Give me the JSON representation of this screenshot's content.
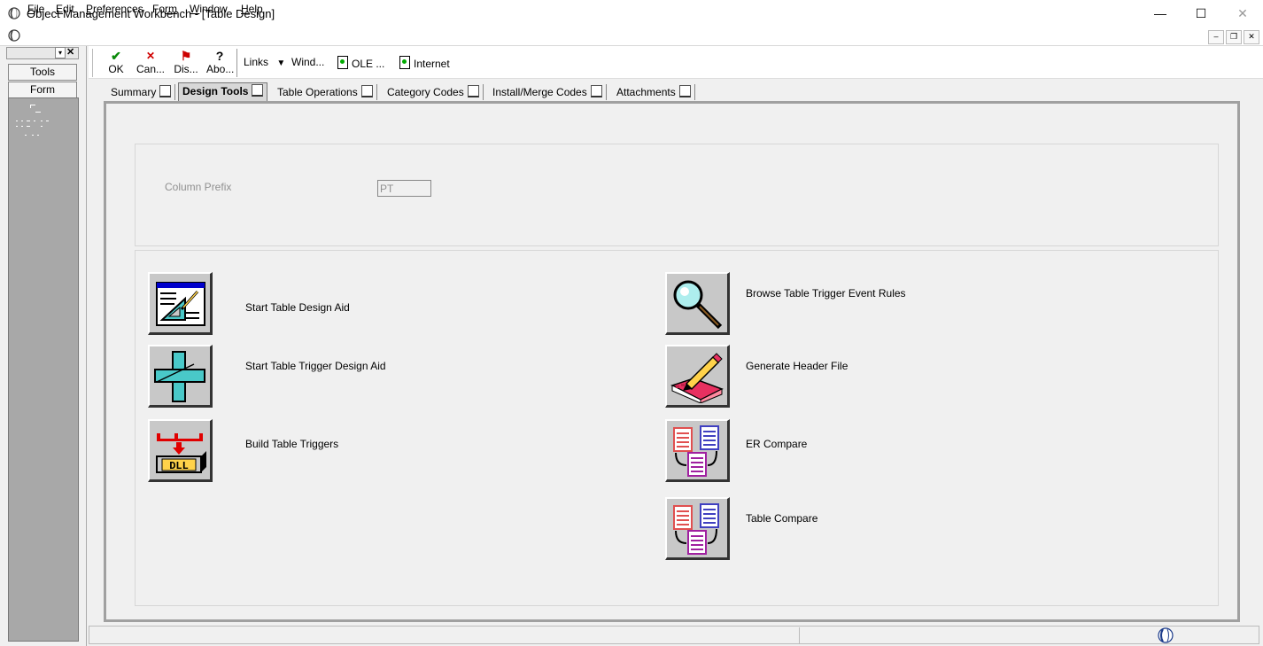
{
  "window": {
    "title": "Object Management Workbench - [Table Design]",
    "minimize_glyph": "—",
    "maximize_glyph": "☐",
    "close_glyph": "✕"
  },
  "menu": {
    "items": [
      {
        "key": "F",
        "rest": "ile"
      },
      {
        "key": "E",
        "rest": "dit"
      },
      {
        "key": "P",
        "rest": "references"
      },
      {
        "key": "Fo",
        "rest": "rm"
      },
      {
        "key": "W",
        "rest": "indow"
      },
      {
        "key": "H",
        "rest": "elp"
      }
    ],
    "mdi_minimize": "–",
    "mdi_restore": "❐",
    "mdi_close": "✕"
  },
  "leftpane": {
    "tabs": [
      "Tools",
      "Form"
    ],
    "pin_glyph": "▾",
    "close_glyph": "✕"
  },
  "toolbar": {
    "buttons": [
      {
        "label": "OK",
        "icon": "check-icon",
        "glyph": "✔",
        "color": "#0a8a0a"
      },
      {
        "label": "Can...",
        "icon": "cancel-x-icon",
        "glyph": "✕",
        "color": "#d00000"
      },
      {
        "label": "Dis...",
        "icon": "display-icon",
        "glyph": "⚑",
        "color": "#cc0000"
      },
      {
        "label": "Abo...",
        "icon": "about-icon",
        "glyph": "?",
        "color": "#000000"
      }
    ],
    "links_label": "Links",
    "links_arrow": "▼",
    "links": [
      "Wind...",
      "OLE ...",
      "Internet"
    ]
  },
  "tabs": [
    {
      "label": "Summary"
    },
    {
      "label": "Design Tools",
      "active": true
    },
    {
      "label": "Table Operations"
    },
    {
      "label": "Category Codes"
    },
    {
      "label": "Install/Merge Codes"
    },
    {
      "label": "Attachments"
    }
  ],
  "form": {
    "column_prefix_label": "Column Prefix",
    "column_prefix_value": "PT"
  },
  "tools_left": [
    {
      "label": "Start Table Design Aid",
      "icon": "table-design-aid-icon"
    },
    {
      "label": "Start Table Trigger Design Aid",
      "icon": "trigger-design-aid-icon"
    },
    {
      "label": "Build Table Triggers",
      "icon": "build-triggers-dll-icon",
      "icon_text": "DLL"
    }
  ],
  "tools_right": [
    {
      "label": "Browse Table Trigger Event Rules",
      "icon": "magnifier-icon"
    },
    {
      "label": "Generate Header File",
      "icon": "pencil-book-icon"
    },
    {
      "label": "ER Compare",
      "icon": "compare-documents-icon"
    },
    {
      "label": "Table Compare",
      "icon": "compare-documents-icon"
    }
  ],
  "colors": {
    "title_bar": "#ffffff",
    "frame_gray": "#a0a0a0",
    "active_tab": "#d8d8d8",
    "tool_button_face": "#c8c8c8"
  }
}
